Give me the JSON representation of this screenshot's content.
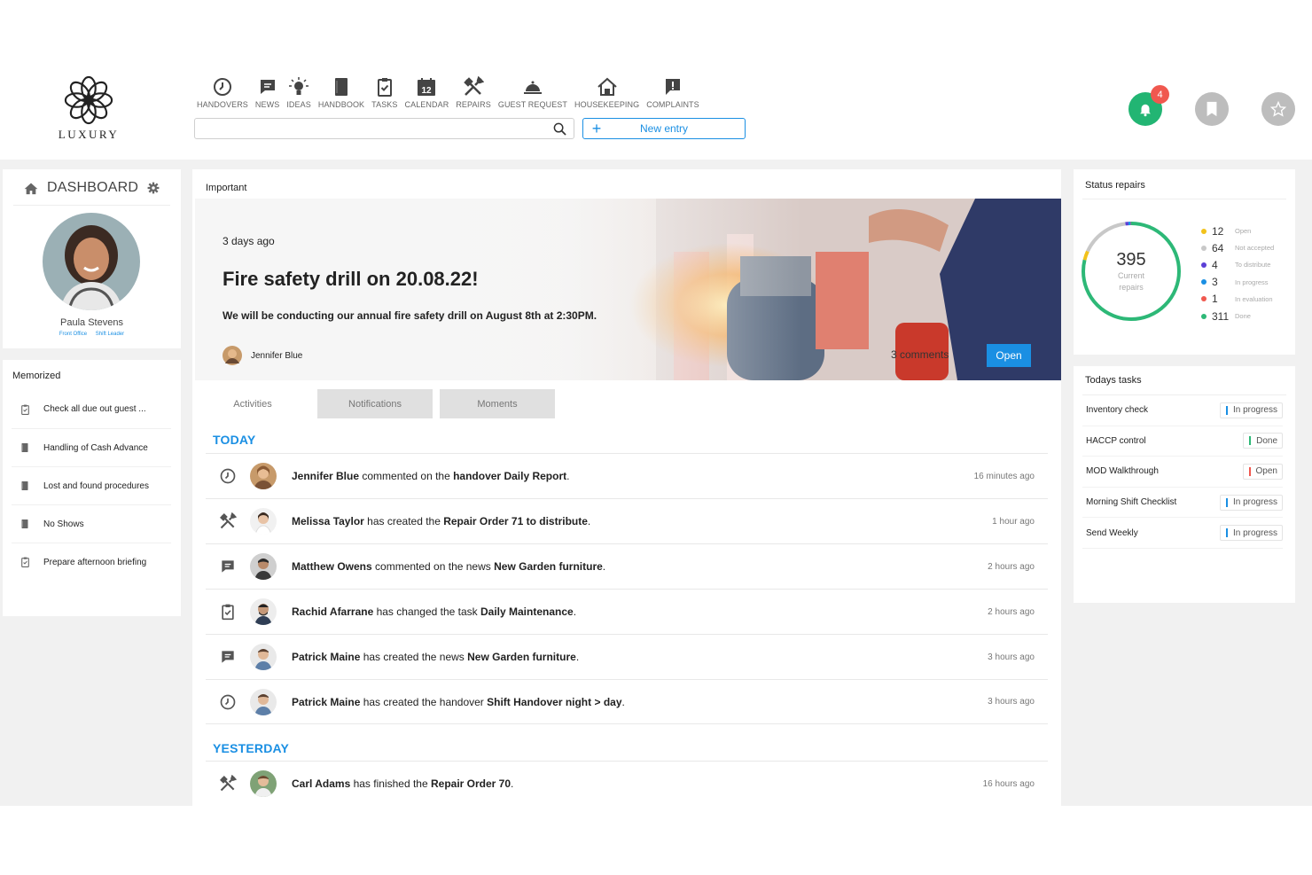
{
  "brand": {
    "name": "LUXURY"
  },
  "nav": [
    {
      "label": "HANDOVERS",
      "icon": "clock-icon"
    },
    {
      "label": "NEWS",
      "icon": "chat-bubble-icon"
    },
    {
      "label": "IDEAS",
      "icon": "lightbulb-icon"
    },
    {
      "label": "HANDBOOK",
      "icon": "book-icon"
    },
    {
      "label": "TASKS",
      "icon": "clipboard-check-icon"
    },
    {
      "label": "CALENDAR",
      "icon": "calendar-icon",
      "calendar_day": "12"
    },
    {
      "label": "REPAIRS",
      "icon": "tools-icon"
    },
    {
      "label": "GUEST REQUEST",
      "icon": "service-bell-icon"
    },
    {
      "label": "HOUSEKEEPING",
      "icon": "house-icon"
    },
    {
      "label": "COMPLAINTS",
      "icon": "exclamation-bubble-icon"
    }
  ],
  "search": {
    "placeholder": "",
    "value": ""
  },
  "new_entry": {
    "plus": "+",
    "label": "New entry"
  },
  "header_actions": {
    "notification_count": "4"
  },
  "dashboard": {
    "title": "DASHBOARD",
    "user_name": "Paula Stevens",
    "roles": [
      "Front Office",
      "Shift Leader"
    ]
  },
  "memorized": {
    "title": "Memorized",
    "items": [
      {
        "label": "Check all due out guest ...",
        "icon": "clipboard-check-icon"
      },
      {
        "label": "Handling of Cash Advance",
        "icon": "book-icon"
      },
      {
        "label": "Lost and found procedures",
        "icon": "book-icon"
      },
      {
        "label": "No Shows",
        "icon": "book-icon"
      },
      {
        "label": "Prepare afternoon briefing",
        "icon": "clipboard-check-icon"
      }
    ]
  },
  "important": {
    "label": "Important",
    "ago": "3 days ago",
    "title": "Fire safety drill on 20.08.22!",
    "description": "We will be conducting our annual fire safety drill  on August 8th at 2:30PM.",
    "author": "Jennifer Blue",
    "comments": "3 comments",
    "open_label": "Open"
  },
  "tabs": [
    "Activities",
    "Notifications",
    "Moments"
  ],
  "feed": {
    "today_label": "TODAY",
    "yesterday_label": "YESTERDAY",
    "today": [
      {
        "icon": "clock-icon",
        "user": "Jennifer Blue",
        "mid": " commented on the ",
        "target": "handover Daily Report",
        "end": ".",
        "time": "16 minutes ago"
      },
      {
        "icon": "tools-icon",
        "user": "Melissa Taylor",
        "mid": " has created the ",
        "target": "Repair Order 71 to distribute",
        "end": ".",
        "time": "1 hour ago"
      },
      {
        "icon": "chat-bubble-icon",
        "user": "Matthew Owens",
        "mid": " commented on the news ",
        "target": "New Garden furniture",
        "end": ".",
        "time": "2 hours ago"
      },
      {
        "icon": "clipboard-check-icon",
        "user": "Rachid Afarrane",
        "mid": " has changed the task ",
        "target": "Daily Maintenance",
        "end": ".",
        "time": "2 hours ago"
      },
      {
        "icon": "chat-bubble-icon",
        "user": "Patrick Maine",
        "mid": " has created the news ",
        "target": "New Garden furniture",
        "end": ".",
        "time": "3 hours ago"
      },
      {
        "icon": "clock-icon",
        "user": "Patrick Maine",
        "mid": " has created the handover ",
        "target": "Shift Handover night > day",
        "end": ".",
        "time": "3 hours ago"
      }
    ],
    "yesterday": [
      {
        "icon": "tools-icon",
        "user": "Carl Adams",
        "mid": " has finished the ",
        "target": "Repair Order 70",
        "end": ".",
        "time": "16 hours ago"
      }
    ]
  },
  "status_repairs": {
    "title": "Status repairs",
    "total": "395",
    "total_label_1": "Current",
    "total_label_2": "repairs",
    "items": [
      {
        "value": 12,
        "label": "Open",
        "color": "#f2c21b"
      },
      {
        "value": 64,
        "label": "Not accepted",
        "color": "#c8c8c8"
      },
      {
        "value": 4,
        "label": "To distribute",
        "color": "#5b3fd6"
      },
      {
        "value": 3,
        "label": "In progress",
        "color": "#1a8fe3"
      },
      {
        "value": 1,
        "label": "In evaluation",
        "color": "#f0584f"
      },
      {
        "value": 311,
        "label": "Done",
        "color": "#2db877"
      }
    ]
  },
  "todays_tasks": {
    "title": "Todays tasks",
    "items": [
      {
        "name": "Inventory check",
        "status": "In progress",
        "color": "#1a8fe3"
      },
      {
        "name": "HACCP control",
        "status": "Done",
        "color": "#2db877"
      },
      {
        "name": "MOD Walkthrough",
        "status": "Open",
        "color": "#f0584f"
      },
      {
        "name": "Morning Shift Checklist",
        "status": "In progress",
        "color": "#1a8fe3"
      },
      {
        "name": "Send Weekly",
        "status": "In progress",
        "color": "#1a8fe3"
      }
    ]
  }
}
